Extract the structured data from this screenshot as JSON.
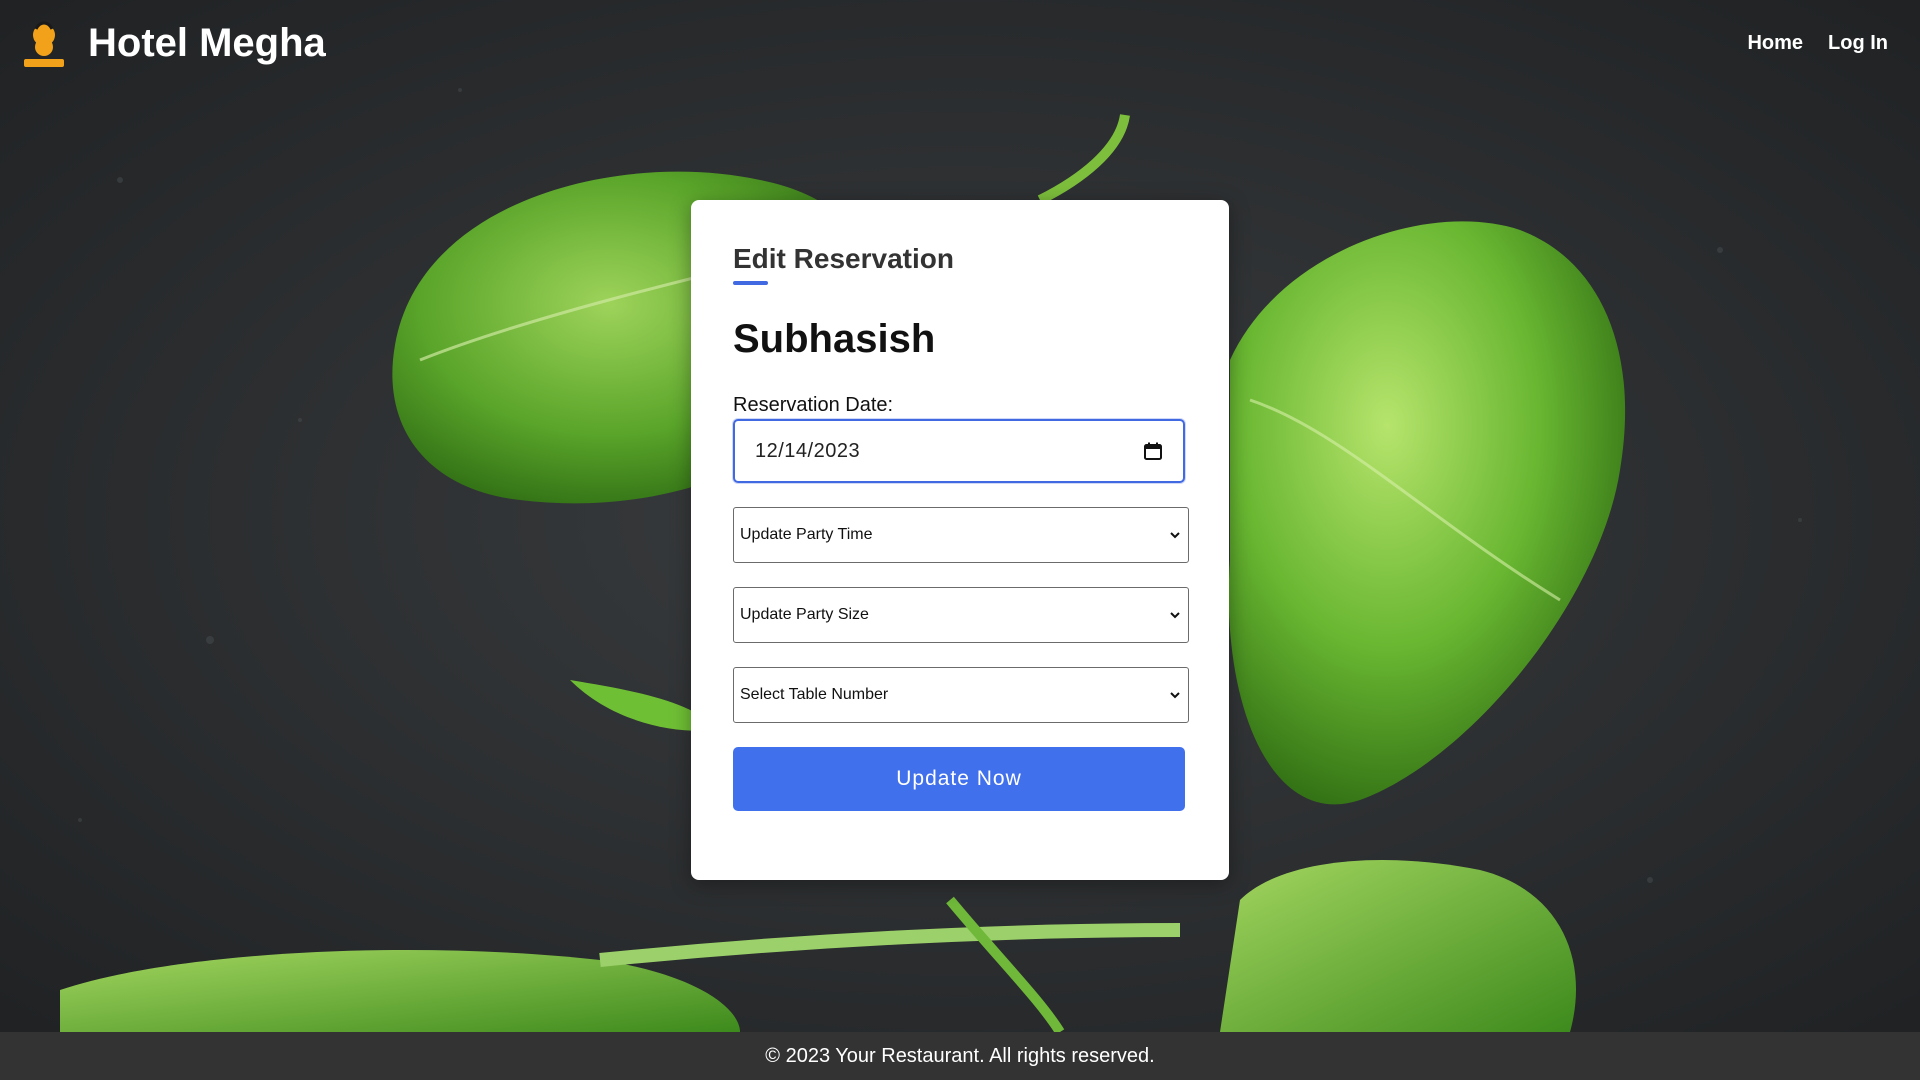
{
  "header": {
    "brand_title": "Hotel Megha",
    "logo_text": "CHEF FOOD",
    "nav": [
      {
        "label": "Home"
      },
      {
        "label": "Log In"
      }
    ]
  },
  "form": {
    "heading": "Edit Reservation",
    "guest_name": "Subhasish",
    "date_label": "Reservation Date:",
    "date_value": "12/14/2023",
    "party_time_selected": "Update Party Time",
    "party_size_selected": "Update Party Size",
    "table_number_selected": "Select Table Number",
    "submit_label": "Update Now"
  },
  "footer": {
    "text": "© 2023 Your Restaurant. All rights reserved."
  },
  "icons": {
    "calendar": "calendar-icon",
    "chevron": "chevron-down-icon",
    "logo": "chef-logo"
  },
  "colors": {
    "accent": "#4170ec",
    "footer_bg": "#333333",
    "card_bg": "#ffffff",
    "background": "#2a2c2d",
    "leaf": "#5aa52a"
  }
}
